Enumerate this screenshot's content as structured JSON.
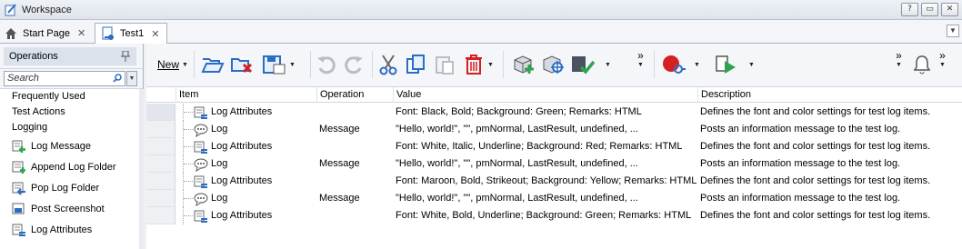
{
  "window": {
    "title": "Workspace",
    "buttons": [
      "?",
      "▭",
      "✕"
    ]
  },
  "tabs": [
    {
      "label": "Start Page",
      "close": "✕"
    },
    {
      "label": "Test1",
      "close": "✕"
    }
  ],
  "operations_panel": {
    "title": "Operations",
    "search_placeholder": "Search",
    "categories": [
      "Frequently Used",
      "Test Actions",
      "Logging"
    ],
    "items": [
      "Log Message",
      "Append Log Folder",
      "Pop Log Folder",
      "Post Screenshot",
      "Log Attributes"
    ]
  },
  "toolbar": {
    "new_label": "New",
    "overflow": "»"
  },
  "grid": {
    "columns": [
      "Item",
      "Operation",
      "Value",
      "Description"
    ],
    "rows": [
      {
        "item": "Log Attributes",
        "icon": "log-attributes-icon",
        "operation": "",
        "value": "Font: Black, Bold; Background: Green; Remarks: HTML",
        "description": "Defines the font and color settings for test log items."
      },
      {
        "item": "Log",
        "icon": "log-message-icon",
        "operation": "Message",
        "value": "\"Hello, world!\", \"\", pmNormal, LastResult, undefined, ...",
        "description": "Posts an information message to the test log."
      },
      {
        "item": "Log Attributes",
        "icon": "log-attributes-icon",
        "operation": "",
        "value": "Font: White, Italic, Underline; Background: Red; Remarks: HTML",
        "description": "Defines the font and color settings for test log items."
      },
      {
        "item": "Log",
        "icon": "log-message-icon",
        "operation": "Message",
        "value": "\"Hello, world!\", \"\", pmNormal, LastResult, undefined, ...",
        "description": "Posts an information message to the test log."
      },
      {
        "item": "Log Attributes",
        "icon": "log-attributes-icon",
        "operation": "",
        "value": "Font: Maroon, Bold, Strikeout; Background: Yellow; Remarks: HTML",
        "description": "Defines the font and color settings for test log items."
      },
      {
        "item": "Log",
        "icon": "log-message-icon",
        "operation": "Message",
        "value": "\"Hello, world!\", \"\", pmNormal, LastResult, undefined, ...",
        "description": "Posts an information message to the test log."
      },
      {
        "item": "Log Attributes",
        "icon": "log-attributes-icon",
        "operation": "",
        "value": "Font: White, Bold, Underline; Background: Green; Remarks: HTML",
        "description": "Defines the font and color settings for test log items."
      }
    ]
  },
  "colors": {
    "accent_blue": "#2b6cc4",
    "green": "#2fa44f",
    "red": "#d42020",
    "tab_border": "#a8b3c4"
  }
}
